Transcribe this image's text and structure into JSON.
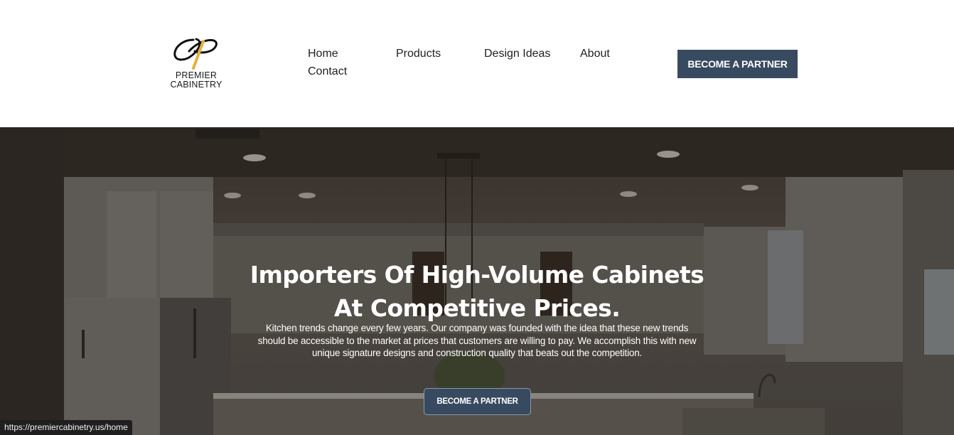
{
  "brand": {
    "logo_line1": "PREMIER",
    "logo_line2": "CABINETRY",
    "gold_color": "#e3b13f",
    "dark_color": "#111111"
  },
  "nav": {
    "items": [
      {
        "label": "Home"
      },
      {
        "label": "Products"
      },
      {
        "label": "Design Ideas"
      },
      {
        "label": "About"
      },
      {
        "label": "Contact"
      }
    ]
  },
  "header": {
    "cta_label": "BECOME A PARTNER",
    "cta_color": "#374a60"
  },
  "hero": {
    "title_line1": "Importers Of High-Volume Cabinets",
    "title_line2": "At Competitive Prices.",
    "description": "Kitchen trends change every few years. Our company was founded with the idea that these new trends should be accessible to the market at prices that customers are willing to pay. We accomplish this with new unique signature designs and construction quality that beats out the competition.",
    "cta_label": "BECOME A PARTNER"
  },
  "status_bar": {
    "url": "https://premiercabinetry.us/home"
  }
}
